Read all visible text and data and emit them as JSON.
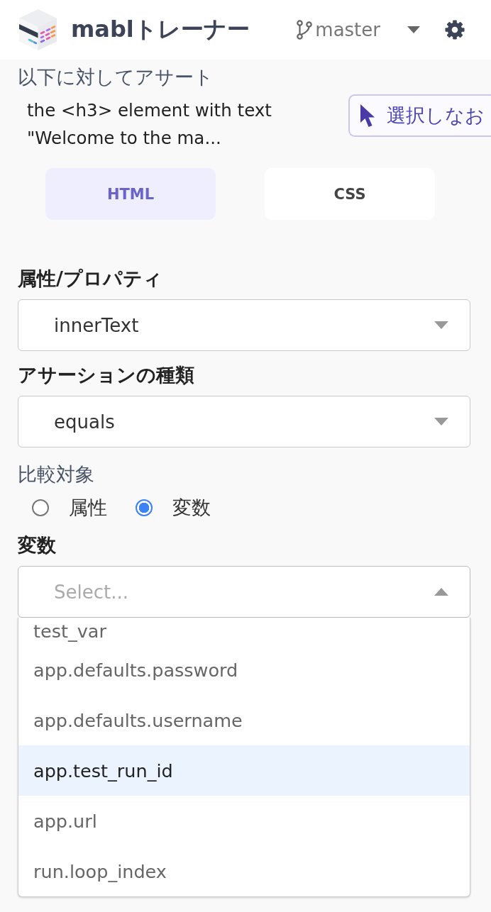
{
  "header": {
    "title": "mablトレーナー",
    "branch": "master"
  },
  "target": {
    "heading": "以下に対してアサート",
    "description": "the <h3> element with text \"Welcome to the ma...",
    "reselect_button": "選択しなお"
  },
  "tabs": [
    {
      "label": "HTML",
      "selected": true
    },
    {
      "label": "CSS",
      "selected": false
    }
  ],
  "form": [
    {
      "kind": "select",
      "label": "属性/プロパティ",
      "value": "innerText",
      "expanded": false
    },
    {
      "kind": "select",
      "label": "アサーションの種類",
      "value": "equals",
      "expanded": false
    },
    {
      "kind": "radio_group",
      "label": "比較対象",
      "options": [
        {
          "label": "属性",
          "selected": false
        },
        {
          "label": "変数",
          "selected": true
        }
      ]
    },
    {
      "kind": "select",
      "label": "変数",
      "placeholder": "Select...",
      "expanded": true,
      "options": [
        {
          "label": "test_var",
          "highlighted": false
        },
        {
          "label": "app.defaults.password",
          "highlighted": false
        },
        {
          "label": "app.defaults.username",
          "highlighted": false
        },
        {
          "label": "app.test_run_id",
          "highlighted": true
        },
        {
          "label": "app.url",
          "highlighted": false
        },
        {
          "label": "run.loop_index",
          "highlighted": false
        }
      ]
    }
  ]
}
